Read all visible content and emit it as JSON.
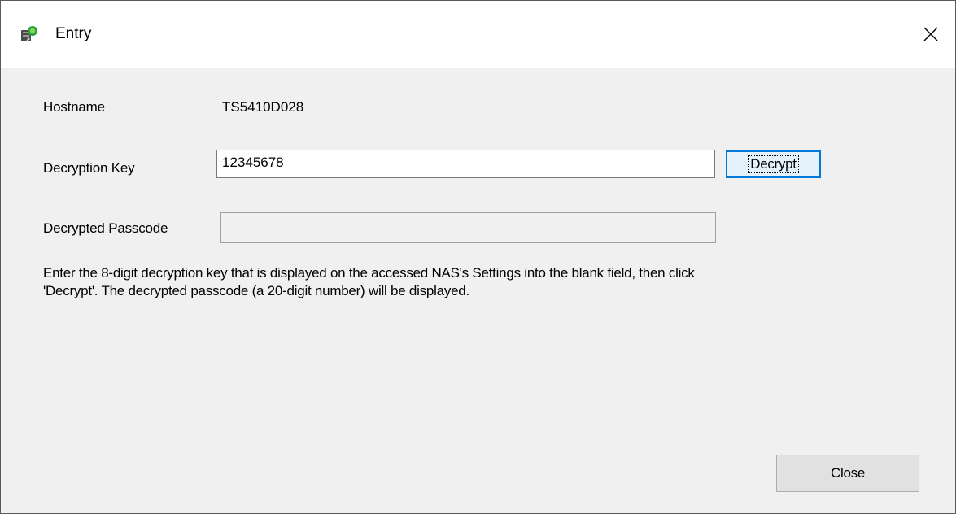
{
  "window": {
    "title": "Entry",
    "close_icon": "close-icon",
    "app_icon": "nas-app-icon"
  },
  "form": {
    "hostname_label": "Hostname",
    "hostname_value": "TS5410D028",
    "decryption_key_label": "Decryption Key",
    "decryption_key_value": "12345678",
    "decrypt_button_label": "Decrypt",
    "decrypted_passcode_label": "Decrypted Passcode",
    "decrypted_passcode_value": ""
  },
  "description": {
    "line1": "Enter the 8-digit decryption key that is displayed on the accessed NAS's Settings into the blank field, then click",
    "line2": "'Decrypt'. The decrypted passcode (a 20-digit number) will be displayed."
  },
  "footer": {
    "close_button_label": "Close"
  },
  "colors": {
    "dialog_background": "#f0f0f0",
    "titlebar_background": "#ffffff",
    "focus_accent": "#0078d7"
  }
}
